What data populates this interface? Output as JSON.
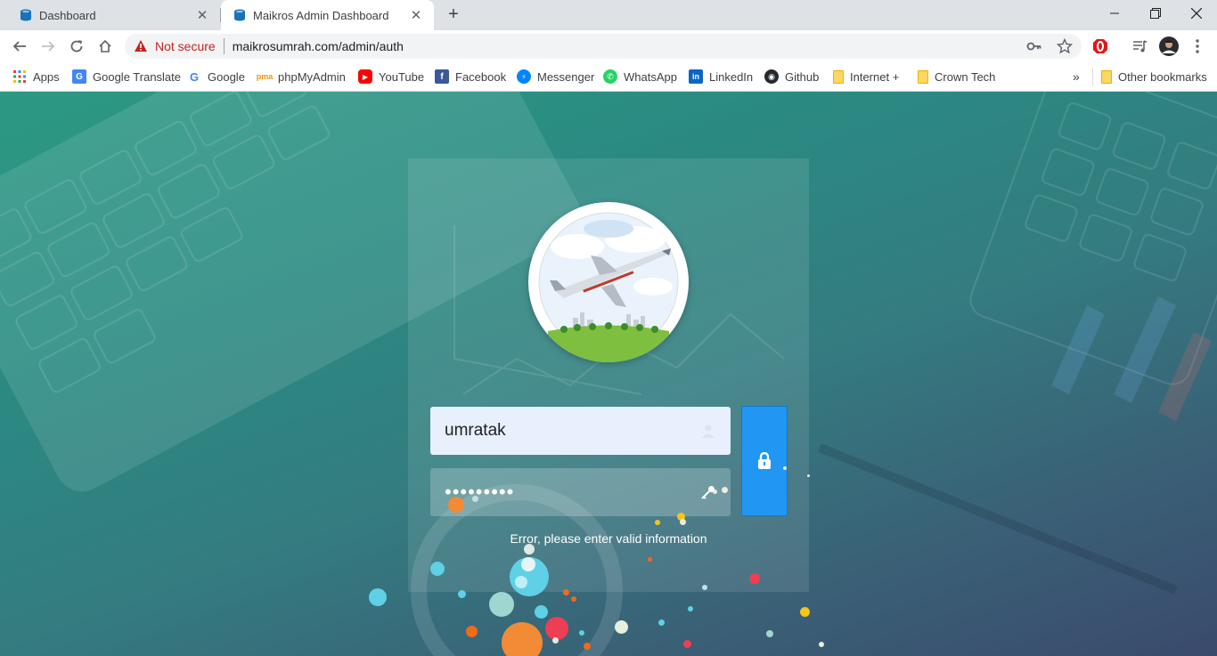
{
  "browser": {
    "tabs": [
      {
        "title": "Dashboard",
        "active": false
      },
      {
        "title": "Maikros Admin Dashboard",
        "active": true
      }
    ],
    "new_tab_label": "+",
    "security_label": "Not secure",
    "url": "maikrosumrah.com/admin/auth",
    "icons": [
      "back-icon",
      "forward-icon",
      "reload-icon",
      "home-icon",
      "key-icon",
      "star-icon",
      "opera-icon",
      "media-icon",
      "avatar",
      "menu-icon"
    ]
  },
  "bookmarks": {
    "items": [
      {
        "label": "Apps",
        "icon": "apps-grid-icon"
      },
      {
        "label": "Google Translate",
        "icon": "google-translate-icon"
      },
      {
        "label": "Google",
        "icon": "google-icon"
      },
      {
        "label": "phpMyAdmin",
        "icon": "phpmyadmin-icon"
      },
      {
        "label": "YouTube",
        "icon": "youtube-icon"
      },
      {
        "label": "Facebook",
        "icon": "facebook-icon"
      },
      {
        "label": "Messenger",
        "icon": "messenger-icon"
      },
      {
        "label": "WhatsApp",
        "icon": "whatsapp-icon"
      },
      {
        "label": "LinkedIn",
        "icon": "linkedin-icon"
      },
      {
        "label": "Github",
        "icon": "github-icon"
      },
      {
        "label": "Internet +",
        "icon": "folder-icon"
      },
      {
        "label": "Crown Tech",
        "icon": "folder-icon"
      }
    ],
    "overflow_label": "»",
    "other_label": "Other bookmarks"
  },
  "login": {
    "username_value": "umratak",
    "password_value": "•••••••••",
    "error_message": "Error, please enter valid information"
  },
  "colors": {
    "accent": "#2196f3",
    "error_text": "#ffffff",
    "not_secure": "#c5221f"
  }
}
